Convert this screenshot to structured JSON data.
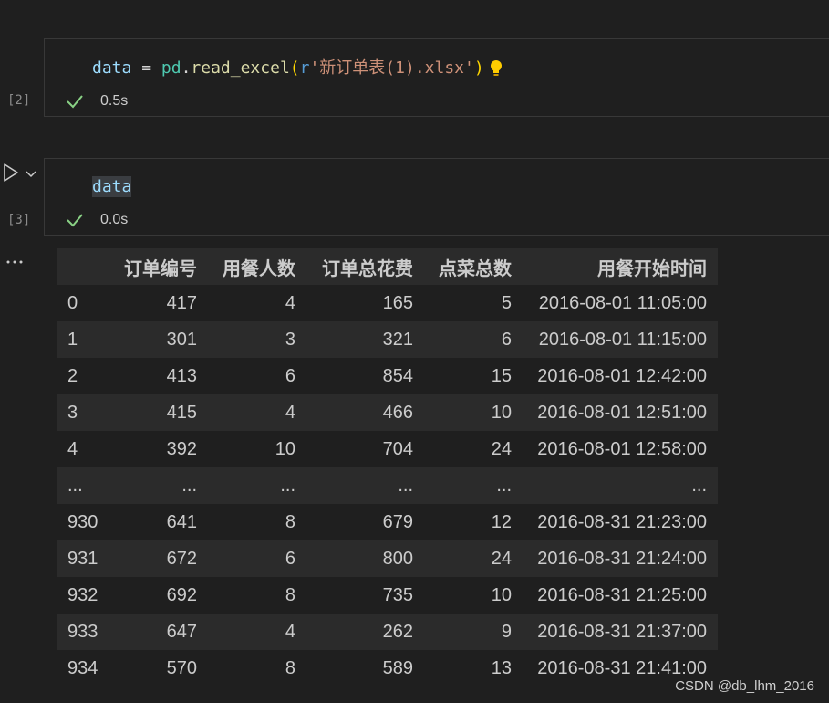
{
  "cells": [
    {
      "exec_count": "[2]",
      "code": {
        "var": "data",
        "eq": " = ",
        "module": "pd",
        "dot": ".",
        "func": "read_excel",
        "open_paren": "(",
        "prefix": "r",
        "string": "'新订单表(1).xlsx'",
        "close_paren": ")"
      },
      "status": "success",
      "duration": "0.5s"
    },
    {
      "exec_count": "[3]",
      "code": {
        "var": "data"
      },
      "status": "success",
      "duration": "0.0s"
    }
  ],
  "output": {
    "columns": [
      "",
      "订单编号",
      "用餐人数",
      "订单总花费",
      "点菜总数",
      "用餐开始时间"
    ],
    "rows": [
      [
        "0",
        "417",
        "4",
        "165",
        "5",
        "2016-08-01 11:05:00"
      ],
      [
        "1",
        "301",
        "3",
        "321",
        "6",
        "2016-08-01 11:15:00"
      ],
      [
        "2",
        "413",
        "6",
        "854",
        "15",
        "2016-08-01 12:42:00"
      ],
      [
        "3",
        "415",
        "4",
        "466",
        "10",
        "2016-08-01 12:51:00"
      ],
      [
        "4",
        "392",
        "10",
        "704",
        "24",
        "2016-08-01 12:58:00"
      ],
      [
        "...",
        "...",
        "...",
        "...",
        "...",
        "..."
      ],
      [
        "930",
        "641",
        "8",
        "679",
        "12",
        "2016-08-31 21:23:00"
      ],
      [
        "931",
        "672",
        "6",
        "800",
        "24",
        "2016-08-31 21:24:00"
      ],
      [
        "932",
        "692",
        "8",
        "735",
        "10",
        "2016-08-31 21:25:00"
      ],
      [
        "933",
        "647",
        "4",
        "262",
        "9",
        "2016-08-31 21:37:00"
      ],
      [
        "934",
        "570",
        "8",
        "589",
        "13",
        "2016-08-31 21:41:00"
      ]
    ]
  },
  "icons": {
    "lightbulb": "lightbulb-icon",
    "check": "check-icon",
    "run": "run-icon",
    "chevron": "chevron-down-icon",
    "more": "ellipsis-icon"
  },
  "colors": {
    "background": "#1f1f1f",
    "check": "#89d185",
    "bulb": "#ffcc00"
  },
  "watermark": "CSDN @db_lhm_2016"
}
